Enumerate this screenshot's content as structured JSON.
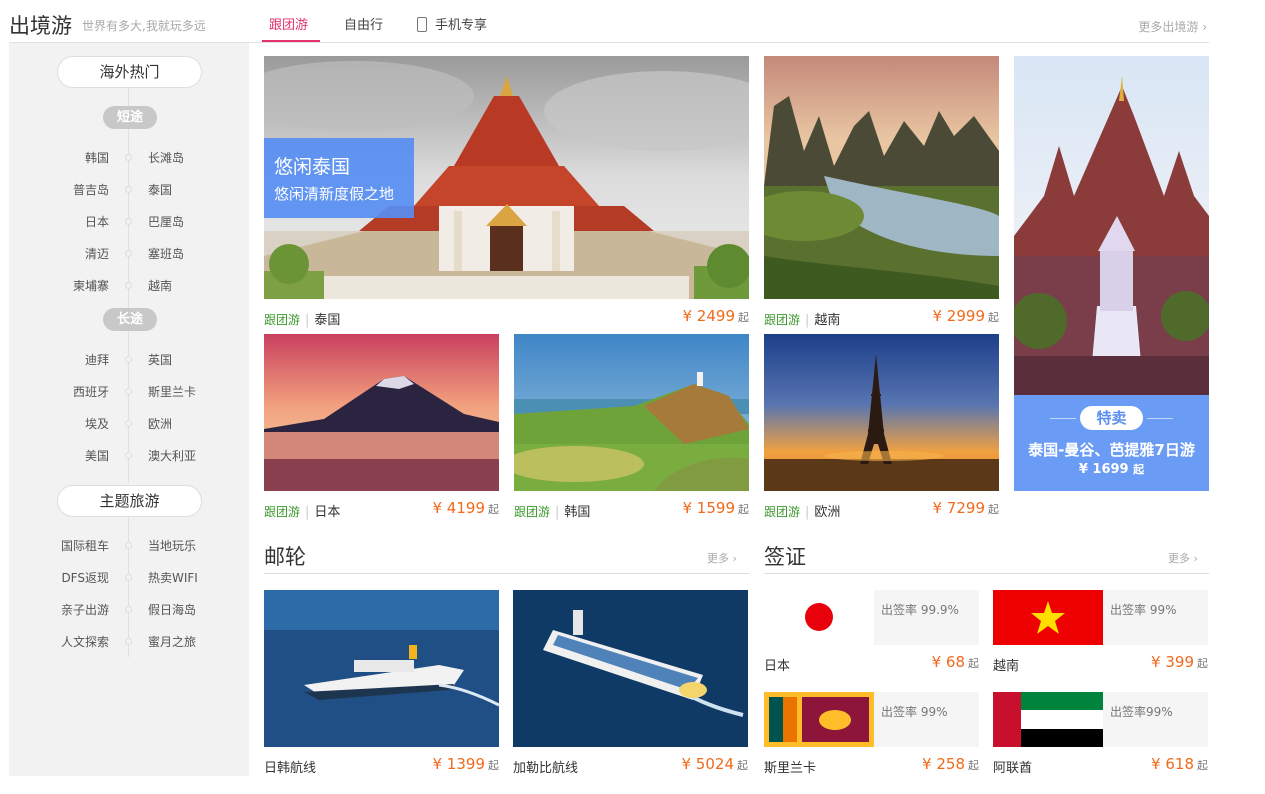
{
  "header": {
    "title": "出境游",
    "subtitle": "世界有多大,我就玩多远",
    "tabs": [
      {
        "label": "跟团游",
        "active": true
      },
      {
        "label": "自由行",
        "active": false
      },
      {
        "label": "手机专享",
        "active": false,
        "icon": "phone-icon"
      }
    ],
    "more": "更多出境游 ›"
  },
  "sidebar": {
    "hot_title": "海外热门",
    "short_label": "短途",
    "short_items": [
      [
        "韩国",
        "长滩岛"
      ],
      [
        "普吉岛",
        "泰国"
      ],
      [
        "日本",
        "巴厘岛"
      ],
      [
        "清迈",
        "塞班岛"
      ],
      [
        "柬埔寨",
        "越南"
      ]
    ],
    "long_label": "长途",
    "long_items": [
      [
        "迪拜",
        "英国"
      ],
      [
        "西班牙",
        "斯里兰卡"
      ],
      [
        "埃及",
        "欧洲"
      ],
      [
        "美国",
        "澳大利亚"
      ]
    ],
    "theme_title": "主题旅游",
    "theme_items": [
      [
        "国际租车",
        "当地玩乐"
      ],
      [
        "DFS返现",
        "热卖WIFI"
      ],
      [
        "亲子出游",
        "假日海岛"
      ],
      [
        "人文探索",
        "蜜月之旅"
      ]
    ]
  },
  "banner": {
    "title": "悠闲泰国",
    "subtitle": "悠闲清新度假之地"
  },
  "cards": [
    {
      "tag": "跟团游",
      "dest": "泰国",
      "price": "¥ 2499",
      "suffix": "起"
    },
    {
      "tag": "跟团游",
      "dest": "越南",
      "price": "¥ 2999",
      "suffix": "起"
    },
    {
      "tag": "跟团游",
      "dest": "日本",
      "price": "¥ 4199",
      "suffix": "起"
    },
    {
      "tag": "跟团游",
      "dest": "韩国",
      "price": "¥ 1599",
      "suffix": "起"
    },
    {
      "tag": "跟团游",
      "dest": "欧洲",
      "price": "¥ 7299",
      "suffix": "起"
    }
  ],
  "promo": {
    "badge": "特卖",
    "title": "泰国-曼谷、芭提雅7日游",
    "price": "¥ 1699",
    "suffix": "起"
  },
  "cruise": {
    "title": "邮轮",
    "more": "更多 ›",
    "items": [
      {
        "name": "日韩航线",
        "price": "¥ 1399",
        "suffix": "起"
      },
      {
        "name": "加勒比航线",
        "price": "¥ 5024",
        "suffix": "起"
      }
    ]
  },
  "visa": {
    "title": "签证",
    "more": "更多 ›",
    "items": [
      {
        "country": "日本",
        "rate": "出签率 99.9%",
        "price": "¥ 68",
        "suffix": "起"
      },
      {
        "country": "越南",
        "rate": "出签率 99%",
        "price": "¥ 399",
        "suffix": "起"
      },
      {
        "country": "斯里兰卡",
        "rate": "出签率 99%",
        "price": "¥ 258",
        "suffix": "起"
      },
      {
        "country": "阿联酋",
        "rate": "出签率99%",
        "price": "¥ 618",
        "suffix": "起"
      }
    ]
  },
  "colors": {
    "accent": "#e2336c",
    "price": "#f26a1b",
    "tag": "#3d9a2e",
    "promo": "#6b9cf5"
  }
}
